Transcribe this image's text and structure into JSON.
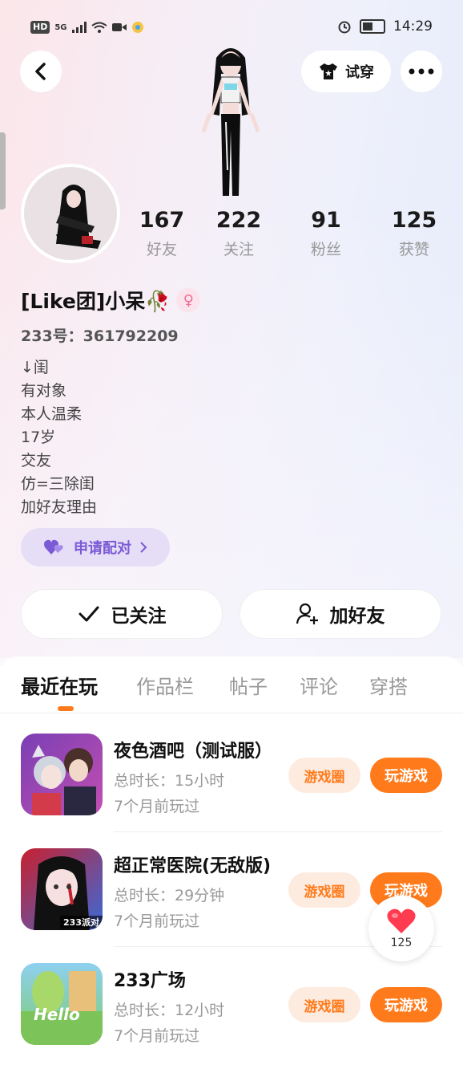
{
  "status_bar": {
    "hd": "HD",
    "network": "5G",
    "time": "14:29"
  },
  "header": {
    "try_on_label": "试穿"
  },
  "stats": [
    {
      "value": "167",
      "label": "好友"
    },
    {
      "value": "222",
      "label": "关注"
    },
    {
      "value": "91",
      "label": "粉丝"
    },
    {
      "value": "125",
      "label": "获赞"
    }
  ],
  "profile": {
    "name": "[Like团]小呆🥀",
    "gender_symbol": "♀",
    "account_id": "233号：361792209",
    "bio_lines": [
      "↓闺",
      "有对象",
      "本人温柔",
      "17岁",
      "交友",
      "仿=三除闺",
      "加好友理由"
    ],
    "match_label": "申请配对"
  },
  "actions": {
    "followed_label": "已关注",
    "add_friend_label": "加好友"
  },
  "tabs": [
    "最近在玩",
    "作品栏",
    "帖子",
    "评论",
    "穿搭"
  ],
  "games": [
    {
      "title": "夜色酒吧（测试服）",
      "duration": "总时长：15小时",
      "last_played": "7个月前玩过",
      "circle_label": "游戏圈",
      "play_label": "玩游戏"
    },
    {
      "title": "超正常医院(无敌版)",
      "duration": "总时长：29分钟",
      "last_played": "7个月前玩过",
      "circle_label": "游戏圈",
      "play_label": "玩游戏",
      "icon_badge": "233派对"
    },
    {
      "title": "233广场",
      "duration": "总时长：12小时",
      "last_played": "7个月前玩过",
      "circle_label": "游戏圈",
      "play_label": "玩游戏",
      "icon_badge": "Hello"
    }
  ],
  "like_fab": {
    "count": "125"
  },
  "colors": {
    "accent": "#ff7a1a",
    "match_purple": "#7b5ad6",
    "gender_pink": "#f06b96"
  }
}
